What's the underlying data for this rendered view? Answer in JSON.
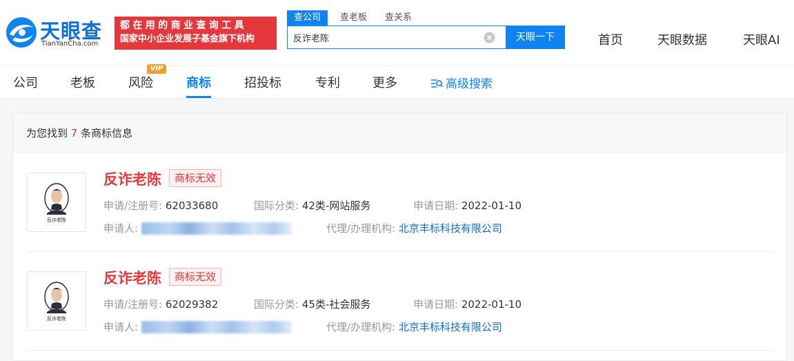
{
  "header": {
    "logo_text": "天眼查",
    "logo_sub": "TianYanCha.com",
    "slogan_line1": "都在用的商业查询工具",
    "slogan_line2": "国家中小企业发展子基金旗下机构",
    "search_tabs": [
      "查公司",
      "查老板",
      "查关系"
    ],
    "search_value": "反诈老陈",
    "search_button": "天眼一下",
    "nav": [
      "首页",
      "天眼数据",
      "天眼AI"
    ]
  },
  "subnav": {
    "items": [
      "公司",
      "老板",
      "风险",
      "商标",
      "招投标",
      "专利",
      "更多"
    ],
    "active": "商标",
    "vip_badge": "VIP",
    "advanced_search": "高级搜索"
  },
  "results": {
    "found_prefix": "为您找到",
    "found_count": "7",
    "found_suffix": "条商标信息",
    "items": [
      {
        "name": "反诈老陈",
        "status": "商标无效",
        "thumb_caption": "反诈老陈",
        "reg_label": "申请/注册号:",
        "reg_no": "62033680",
        "class_label": "国际分类:",
        "class_value": "42类-网站服务",
        "date_label": "申请日期:",
        "date_value": "2022-01-10",
        "applicant_label": "申请人:",
        "agent_label": "代理/办理机构:",
        "agent_value": "北京丰标科技有限公司"
      },
      {
        "name": "反诈老陈",
        "status": "商标无效",
        "thumb_caption": "反诈老陈",
        "reg_label": "申请/注册号:",
        "reg_no": "62029382",
        "class_label": "国际分类:",
        "class_value": "45类-社会服务",
        "date_label": "申请日期:",
        "date_value": "2022-01-10",
        "applicant_label": "申请人:",
        "agent_label": "代理/办理机构:",
        "agent_value": "北京丰标科技有限公司"
      }
    ]
  },
  "colors": {
    "brand_blue": "#0e84f0",
    "brand_red": "#e4393c"
  }
}
